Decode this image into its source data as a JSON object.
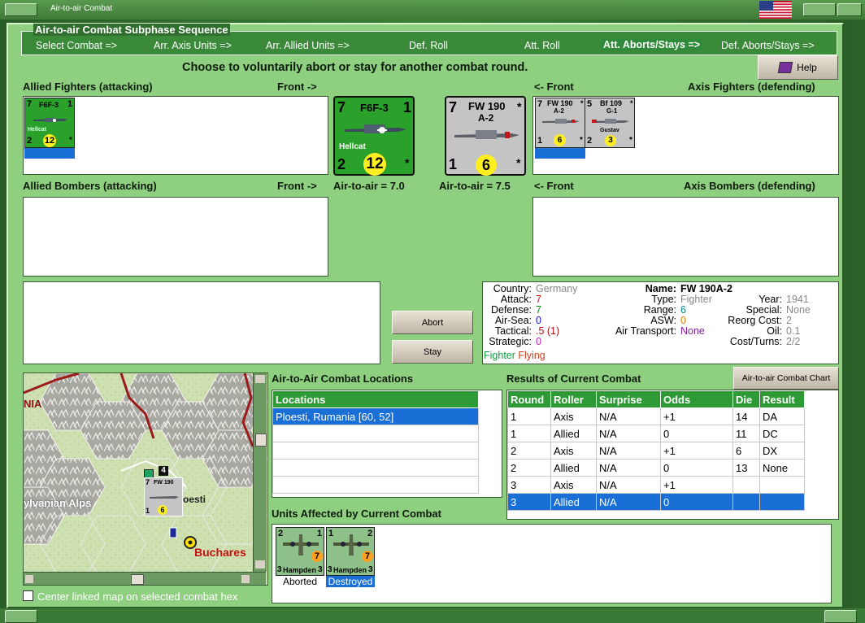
{
  "window": {
    "title": "Air-to-air Combat"
  },
  "subphase": {
    "caption": "Air-to-air Combat Subphase Sequence",
    "steps": [
      "Select Combat =>",
      "Arr. Axis Units =>",
      "Arr. Allied Units =>",
      "Def. Roll",
      "Att. Roll",
      "Att. Aborts/Stays =>",
      "Def. Aborts/Stays =>"
    ]
  },
  "instruction": "Choose to voluntarily abort or stay for another combat round.",
  "help_label": "Help",
  "panels": {
    "allied_fighters": "Allied Fighters (attacking)",
    "front_right": "Front ->",
    "front_left": "<- Front",
    "axis_fighters": "Axis Fighters (defending)",
    "allied_bombers": "Allied Bombers (attacking)",
    "axis_bombers": "Axis Bombers (defending)",
    "allied_a2a": "Air-to-air = 7.0",
    "axis_a2a": "Air-to-air = 7.5"
  },
  "allied_unit": {
    "name": "F6F-3",
    "nick": "Hellcat",
    "att": "7",
    "range": "1",
    "def": "2",
    "a2a": "12",
    "star": "*"
  },
  "axis_unit": {
    "name1": "FW 190",
    "name2": "A-2",
    "att": "7",
    "def": "1",
    "a2a": "6",
    "star": "*"
  },
  "axis_small": [
    {
      "name1": "FW 190",
      "name2": "A-2",
      "att": "7",
      "def": "1",
      "a2a": "6",
      "star": "*"
    },
    {
      "name1": "Bf 109",
      "name2": "G-1",
      "nick": "Gustav",
      "att": "5",
      "def": "2",
      "a2a": "3",
      "star": "*"
    }
  ],
  "buttons": {
    "abort": "Abort",
    "stay": "Stay",
    "chart": "Air-to-air Combat Chart"
  },
  "info": {
    "country_k": "Country:",
    "country_v": "Germany",
    "attack_k": "Attack:",
    "attack_v": "7",
    "defense_k": "Defense:",
    "defense_v": "7",
    "airsea_k": "Air-Sea:",
    "airsea_v": "0",
    "tactical_k": "Tactical:",
    "tactical_v": ".5 (1)",
    "strategic_k": "Strategic:",
    "strategic_v": "0",
    "role1": "Fighter",
    "role2": "Flying",
    "name_k": "Name:",
    "name_v": "FW 190A-2",
    "type_k": "Type:",
    "type_v": "Fighter",
    "range_k": "Range:",
    "range_v": "6",
    "asw_k": "ASW:",
    "asw_v": "0",
    "transport_k": "Air Transport:",
    "transport_v": "None",
    "year_k": "Year:",
    "year_v": "1941",
    "special_k": "Special:",
    "special_v": "None",
    "reorg_k": "Reorg Cost:",
    "reorg_v": "2",
    "oil_k": "Oil:",
    "oil_v": "0.1",
    "cost_k": "Cost/Turns:",
    "cost_v": "2/2"
  },
  "map": {
    "label_rania": "NIA",
    "label_alps": "ylvanian Alps",
    "label_pesti": "oesti",
    "label_buch": "Buchares",
    "stack": "4",
    "checkbox": "Center linked map on selected combat hex"
  },
  "locations": {
    "title": "Air-to-Air Combat Locations",
    "header": "Locations",
    "rows": [
      "Ploesti, Rumania [60, 52]"
    ]
  },
  "results": {
    "title": "Results of Current Combat",
    "headers": [
      "Round",
      "Roller",
      "Surprise",
      "Odds",
      "Die",
      "Result"
    ],
    "rows": [
      [
        "1",
        "Axis",
        "N/A",
        "+1",
        "14",
        "DA"
      ],
      [
        "1",
        "Allied",
        "N/A",
        "0",
        "11",
        "DC"
      ],
      [
        "2",
        "Axis",
        "N/A",
        "+1",
        "6",
        "DX"
      ],
      [
        "2",
        "Allied",
        "N/A",
        "0",
        "13",
        "None"
      ],
      [
        "3",
        "Axis",
        "N/A",
        "+1",
        "",
        ""
      ],
      [
        "3",
        "Allied",
        "N/A",
        "0",
        "",
        ""
      ]
    ]
  },
  "affected": {
    "title": "Units Affected by Current Combat",
    "units": [
      {
        "name": "Hampden",
        "tl": "2",
        "tr": "1",
        "bl": "3",
        "br": "3",
        "val": "7",
        "status": "Aborted"
      },
      {
        "name": "Hampden",
        "tl": "1",
        "tr": "2",
        "bl": "3",
        "br": "3",
        "val": "7",
        "status": "Destroyed"
      }
    ]
  },
  "colors": {
    "panel": "#8fd080",
    "frame": "#2f6e2c",
    "header": "#2e9a36",
    "select": "#1a6fd6",
    "allied": "#2aa12a",
    "axis": "#c4c4c4"
  }
}
